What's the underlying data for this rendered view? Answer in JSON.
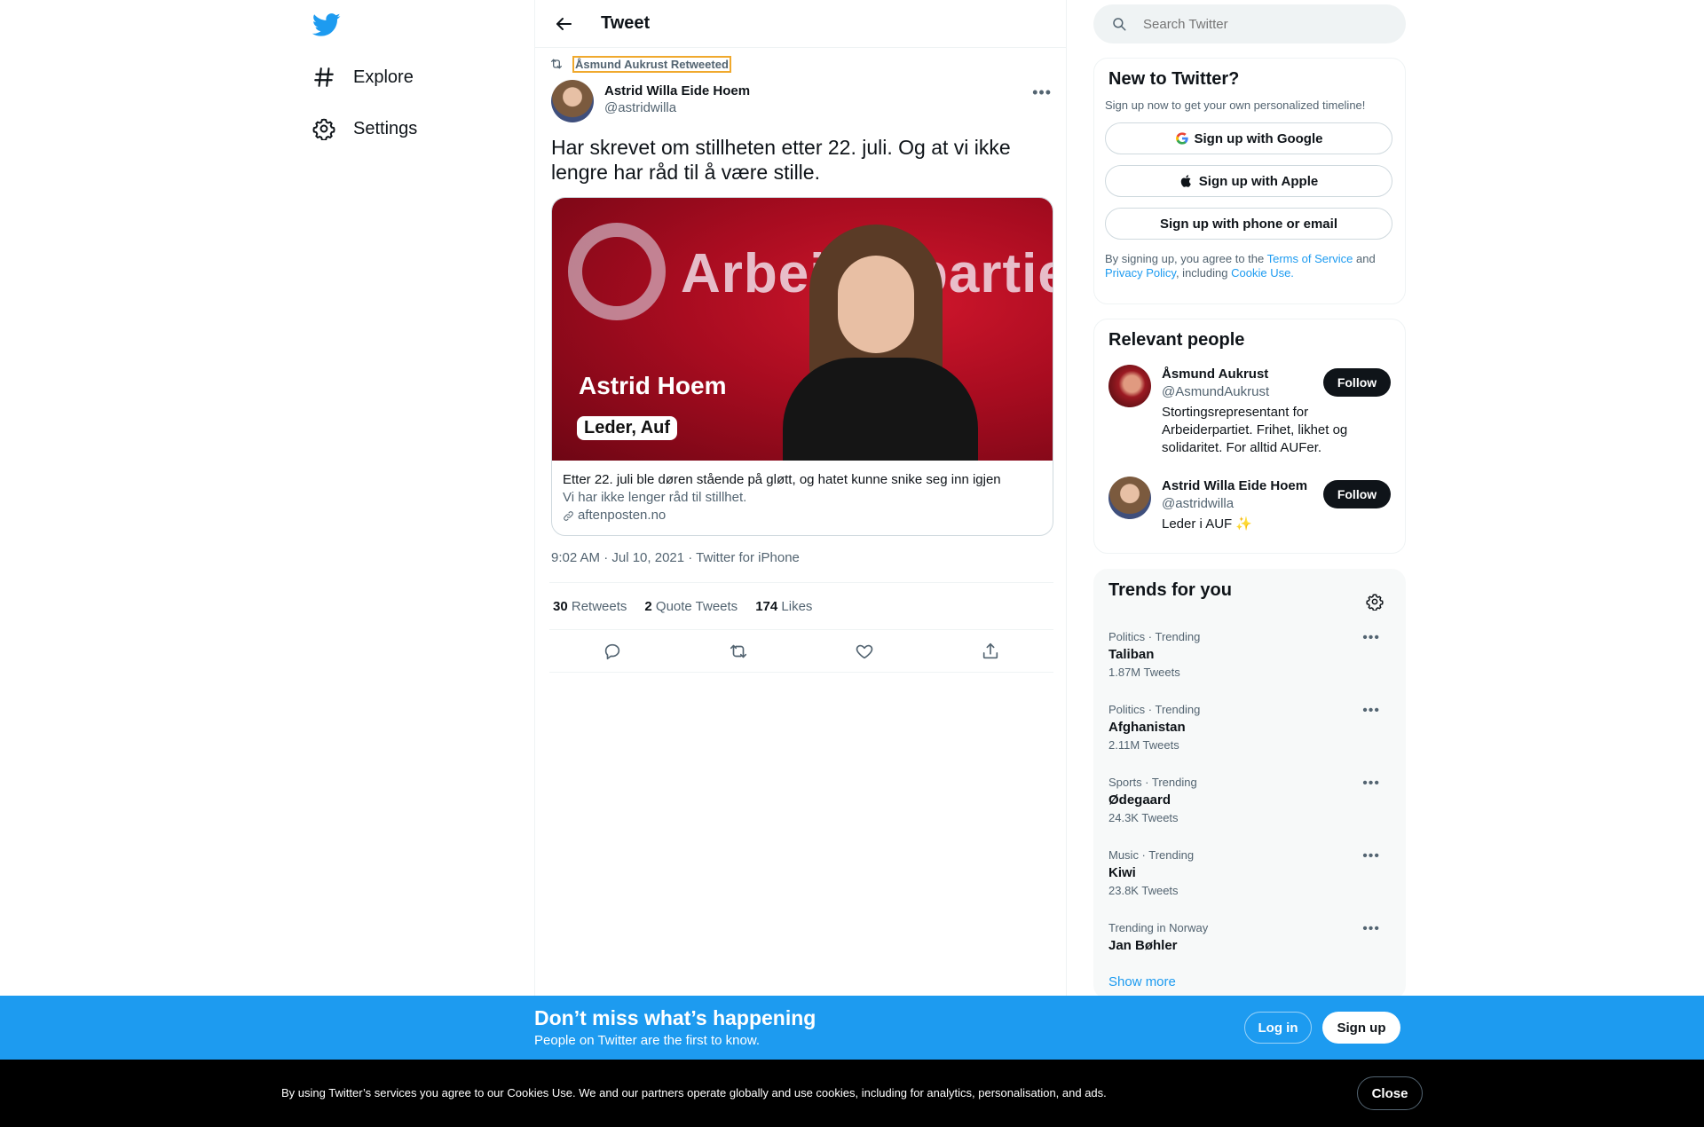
{
  "nav": {
    "logo_icon": "twitter-bird-icon",
    "explore_label": "Explore",
    "settings_label": "Settings"
  },
  "header": {
    "title": "Tweet"
  },
  "tweet": {
    "retweeted_by": "Åsmund Aukrust Retweeted",
    "author_name": "Astrid Willa Eide Hoem",
    "author_handle": "@astridwilla",
    "text": "Har skrevet om stillheten etter 22. juli. Og at vi ikke lengre har råd til å være stille.",
    "card": {
      "image_background_word": "Arbeiderpartiet",
      "image_name_overlay": "Astrid Hoem",
      "image_role_overlay": "Leder, Auf",
      "title": "Etter 22. juli ble døren stående på gløtt, og hatet kunne snike seg inn igjen",
      "description": "Vi har ikke lenger råd til stillhet.",
      "domain": "aftenposten.no"
    },
    "timestamp": "9:02 AM · Jul 10, 2021 · Twitter for iPhone",
    "stats": {
      "retweets_count": "30",
      "retweets_label": "Retweets",
      "quotes_count": "2",
      "quotes_label": "Quote Tweets",
      "likes_count": "174",
      "likes_label": "Likes"
    }
  },
  "search": {
    "placeholder": "Search Twitter"
  },
  "new_to_twitter": {
    "title": "New to Twitter?",
    "subtitle": "Sign up now to get your own personalized timeline!",
    "google_label": "Sign up with Google",
    "apple_label": "Sign up with Apple",
    "phone_label": "Sign up with phone or email",
    "terms_prefix": "By signing up, you agree to the ",
    "terms_link": "Terms of Service",
    "terms_and": " and",
    "privacy_link": "Privacy Policy",
    "terms_including": ", including ",
    "cookie_link": "Cookie Use."
  },
  "relevant_people": {
    "title": "Relevant people",
    "people": [
      {
        "name": "Åsmund Aukrust",
        "handle": "@AsmundAukrust",
        "bio": "Stortingsrepresentant for Arbeiderpartiet. Frihet, likhet og solidaritet. For alltid AUFer.",
        "follow_label": "Follow"
      },
      {
        "name": "Astrid Willa Eide Hoem",
        "handle": "@astridwilla",
        "bio": "Leder i AUF ✨",
        "follow_label": "Follow"
      }
    ]
  },
  "trends": {
    "title": "Trends for you",
    "items": [
      {
        "meta": "Politics · Trending",
        "name": "Taliban",
        "count": "1.87M Tweets"
      },
      {
        "meta": "Politics · Trending",
        "name": "Afghanistan",
        "count": "2.11M Tweets"
      },
      {
        "meta": "Sports · Trending",
        "name": "Ødegaard",
        "count": "24.3K Tweets"
      },
      {
        "meta": "Music · Trending",
        "name": "Kiwi",
        "count": "23.8K Tweets"
      },
      {
        "meta": "Trending in Norway",
        "name": "Jan Bøhler",
        "count": ""
      }
    ],
    "show_more": "Show more"
  },
  "bottom_bar": {
    "title": "Don’t miss what’s happening",
    "subtitle": "People on Twitter are the first to know.",
    "login_label": "Log in",
    "signup_label": "Sign up"
  },
  "cookie_banner": {
    "text": "By using Twitter’s services you agree to our Cookies Use. We and our partners operate globally and use cookies, including for analytics, personalisation, and ads.",
    "close_label": "Close"
  },
  "colors": {
    "accent": "#1d9bf0",
    "text_primary": "#0f1419",
    "text_secondary": "#536471",
    "follow_button": "#0f1419",
    "cookie_bar": "#000000"
  }
}
